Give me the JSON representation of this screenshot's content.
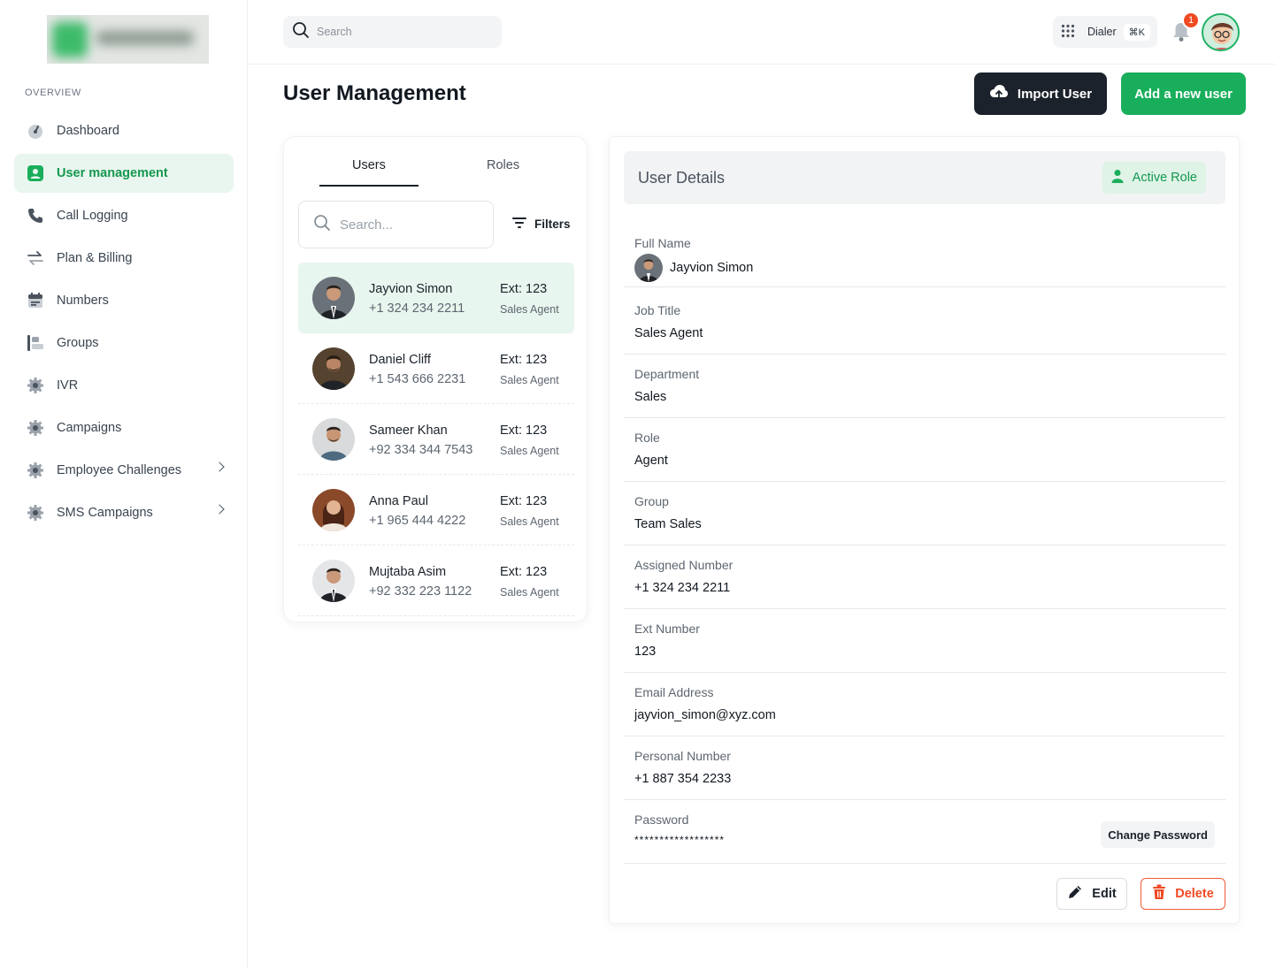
{
  "sidebar": {
    "section_label": "OVERVIEW",
    "items": [
      {
        "label": "Dashboard",
        "icon": "gauge-icon"
      },
      {
        "label": "User management",
        "icon": "user-badge-icon",
        "active": true
      },
      {
        "label": "Call Logging",
        "icon": "phone-icon"
      },
      {
        "label": "Plan & Billing",
        "icon": "swap-arrows-icon"
      },
      {
        "label": "Numbers",
        "icon": "calendar-icon"
      },
      {
        "label": "Groups",
        "icon": "groups-icon"
      },
      {
        "label": "IVR",
        "icon": "gear-icon"
      },
      {
        "label": "Campaigns",
        "icon": "gear-icon"
      },
      {
        "label": "Employee Challenges",
        "icon": "gear-icon",
        "has_submenu": true
      },
      {
        "label": "SMS Campaigns",
        "icon": "gear-icon",
        "has_submenu": true
      }
    ]
  },
  "topbar": {
    "search_placeholder": "Search",
    "dialer_label": "Dialer",
    "dialer_shortcut": "⌘K",
    "notification_count": "1"
  },
  "header": {
    "title": "User Management",
    "import_label": "Import User",
    "add_label": "Add a new user"
  },
  "users_panel": {
    "tabs": [
      "Users",
      "Roles"
    ],
    "search_placeholder": "Search...",
    "filters_label": "Filters",
    "users": [
      {
        "name": "Jayvion Simon",
        "phone": "+1 324 234 2211",
        "ext": "Ext: 123",
        "role": "Sales Agent",
        "selected": true
      },
      {
        "name": "Daniel Cliff",
        "phone": "+1 543 666 2231",
        "ext": "Ext: 123",
        "role": "Sales Agent"
      },
      {
        "name": "Sameer Khan",
        "phone": "+92 334 344 7543",
        "ext": "Ext: 123",
        "role": "Sales Agent"
      },
      {
        "name": "Anna Paul",
        "phone": "+1 965 444 4222",
        "ext": "Ext: 123",
        "role": "Sales Agent"
      },
      {
        "name": "Mujtaba Asim",
        "phone": "+92 332 223 1122",
        "ext": "Ext: 123",
        "role": "Sales Agent"
      }
    ]
  },
  "details": {
    "title": "User Details",
    "active_role_label": "Active Role",
    "fields": [
      {
        "label": "Full Name",
        "value": "Jayvion Simon"
      },
      {
        "label": "Job Title",
        "value": "Sales Agent"
      },
      {
        "label": "Department",
        "value": "Sales"
      },
      {
        "label": "Role",
        "value": "Agent"
      },
      {
        "label": "Group",
        "value": "Team Sales"
      },
      {
        "label": "Assigned Number",
        "value": "+1 324 234 2211"
      },
      {
        "label": "Ext Number",
        "value": "123"
      },
      {
        "label": "Email Address",
        "value": "jayvion_simon@xyz.com"
      },
      {
        "label": "Personal Number",
        "value": "+1 887 354 2233"
      },
      {
        "label": "Password",
        "value": "******************"
      }
    ],
    "change_password_label": "Change Password",
    "edit_label": "Edit",
    "delete_label": "Delete"
  },
  "colors": {
    "accent": "#19ae5c",
    "dark": "#1b222b",
    "danger": "#f04a23"
  }
}
